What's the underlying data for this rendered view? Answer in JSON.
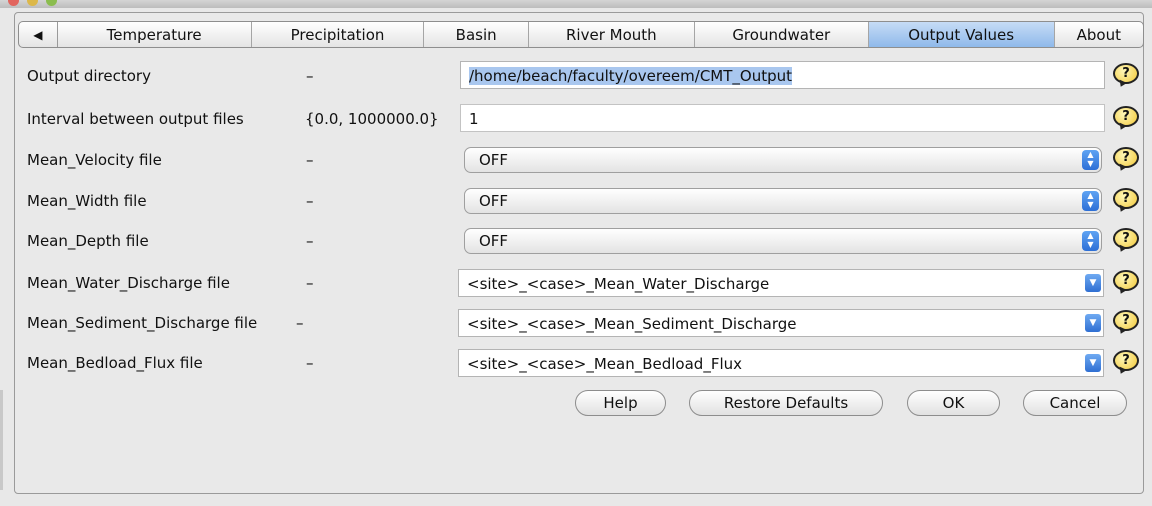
{
  "tabs": [
    {
      "label": "Temperature",
      "active": false
    },
    {
      "label": "Precipitation",
      "active": false
    },
    {
      "label": "Basin",
      "active": false
    },
    {
      "label": "River Mouth",
      "active": false
    },
    {
      "label": "Groundwater",
      "active": false
    },
    {
      "label": "Output Values",
      "active": true
    },
    {
      "label": "About",
      "active": false
    }
  ],
  "tab_scroll_glyph": "◀",
  "help_glyph": "?",
  "rows": [
    {
      "label": "Output directory",
      "range": "–",
      "value": "/home/beach/faculty/overeem/CMT_Output",
      "value_selected": true
    },
    {
      "label": "Interval between output files",
      "range": "{0.0, 1000000.0}",
      "value": "1"
    },
    {
      "label": "Mean_Velocity file",
      "range": "–",
      "value": "OFF"
    },
    {
      "label": "Mean_Width file",
      "range": "–",
      "value": "OFF"
    },
    {
      "label": "Mean_Depth file",
      "range": "–",
      "value": "OFF"
    },
    {
      "label": "Mean_Water_Discharge file",
      "range": "–",
      "value": "<site>_<case>_Mean_Water_Discharge"
    },
    {
      "label": "Mean_Sediment_Discharge file",
      "range": "–",
      "value": "<site>_<case>_Mean_Sediment_Discharge"
    },
    {
      "label": "Mean_Bedload_Flux file",
      "range": "–",
      "value": "<site>_<case>_Mean_Bedload_Flux"
    }
  ],
  "buttons": {
    "help": "Help",
    "restore": "Restore Defaults",
    "ok": "OK",
    "cancel": "Cancel"
  },
  "colors": {
    "active_tab": "#a9c9f0",
    "selection": "#a9c7ef",
    "combo_accent": "#2f6fd2"
  }
}
